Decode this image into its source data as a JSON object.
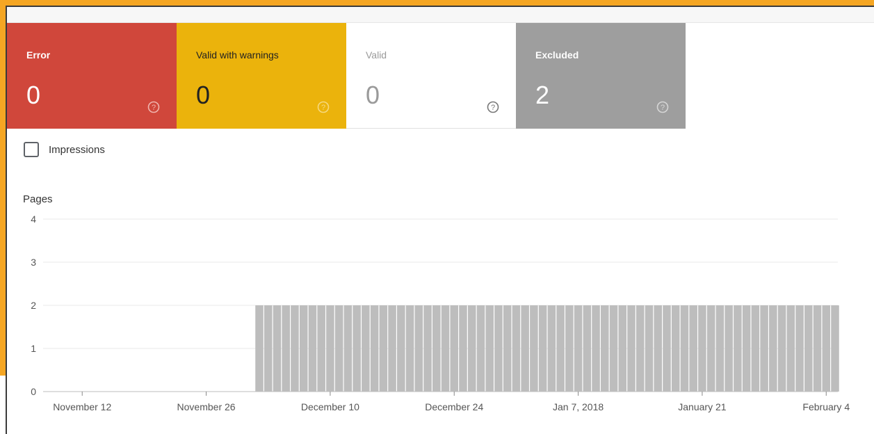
{
  "cards": [
    {
      "label": "Error",
      "value": "0",
      "help_icon": "help-circle-icon",
      "color": "#d0473b"
    },
    {
      "label": "Valid with warnings",
      "value": "0",
      "help_icon": "help-circle-icon",
      "color": "#ebb30c"
    },
    {
      "label": "Valid",
      "value": "0",
      "help_icon": "help-circle-icon",
      "color": "#ffffff"
    },
    {
      "label": "Excluded",
      "value": "2",
      "help_icon": "help-circle-icon",
      "color": "#9e9e9e"
    }
  ],
  "impressions_toggle": {
    "label": "Impressions",
    "checked": false
  },
  "chart_data": {
    "type": "bar",
    "ylabel": "Pages",
    "ylim": [
      0,
      4
    ],
    "yticks": [
      0,
      1,
      2,
      3,
      4
    ],
    "xtick_labels": [
      "November 12",
      "November 26",
      "December 10",
      "December 24",
      "Jan 7, 2018",
      "January 21",
      "February 4"
    ],
    "grid": true,
    "bar_color": "#bdbdbd",
    "series": [
      {
        "categories": [
          "2017-11-09",
          "2017-11-10",
          "2017-11-11",
          "2017-11-12",
          "2017-11-13",
          "2017-11-14",
          "2017-11-15",
          "2017-11-16",
          "2017-11-17",
          "2017-11-18",
          "2017-11-19",
          "2017-11-20",
          "2017-11-21",
          "2017-11-22",
          "2017-11-23",
          "2017-11-24",
          "2017-11-25",
          "2017-11-26",
          "2017-11-27",
          "2017-11-28",
          "2017-11-29",
          "2017-11-30",
          "2017-12-01",
          "2017-12-02",
          "2017-12-03",
          "2017-12-04",
          "2017-12-05",
          "2017-12-06",
          "2017-12-07",
          "2017-12-08",
          "2017-12-09",
          "2017-12-10",
          "2017-12-11",
          "2017-12-12",
          "2017-12-13",
          "2017-12-14",
          "2017-12-15",
          "2017-12-16",
          "2017-12-17",
          "2017-12-18",
          "2017-12-19",
          "2017-12-20",
          "2017-12-21",
          "2017-12-22",
          "2017-12-23",
          "2017-12-24",
          "2017-12-25",
          "2017-12-26",
          "2017-12-27",
          "2017-12-28",
          "2017-12-29",
          "2017-12-30",
          "2017-12-31",
          "2018-01-01",
          "2018-01-02",
          "2018-01-03",
          "2018-01-04",
          "2018-01-05",
          "2018-01-06",
          "2018-01-07",
          "2018-01-08",
          "2018-01-09",
          "2018-01-10",
          "2018-01-11",
          "2018-01-12",
          "2018-01-13",
          "2018-01-14",
          "2018-01-15",
          "2018-01-16",
          "2018-01-17",
          "2018-01-18",
          "2018-01-19",
          "2018-01-20",
          "2018-01-21",
          "2018-01-22",
          "2018-01-23",
          "2018-01-24",
          "2018-01-25",
          "2018-01-26",
          "2018-01-27",
          "2018-01-28",
          "2018-01-29",
          "2018-01-30",
          "2018-01-31",
          "2018-02-01",
          "2018-02-02",
          "2018-02-03",
          "2018-02-04",
          "2018-02-05"
        ],
        "values": [
          0,
          0,
          0,
          0,
          0,
          0,
          0,
          0,
          0,
          0,
          0,
          0,
          0,
          0,
          0,
          0,
          0,
          0,
          0,
          0,
          0,
          0,
          0,
          2,
          2,
          2,
          2,
          2,
          2,
          2,
          2,
          2,
          2,
          2,
          2,
          2,
          2,
          2,
          2,
          2,
          2,
          2,
          2,
          2,
          2,
          2,
          2,
          2,
          2,
          2,
          2,
          2,
          2,
          2,
          2,
          2,
          2,
          2,
          2,
          2,
          2,
          2,
          2,
          2,
          2,
          2,
          2,
          2,
          2,
          2,
          2,
          2,
          2,
          2,
          2,
          2,
          2,
          2,
          2,
          2,
          2,
          2,
          2,
          2,
          2,
          2,
          2,
          2,
          2
        ]
      }
    ]
  }
}
